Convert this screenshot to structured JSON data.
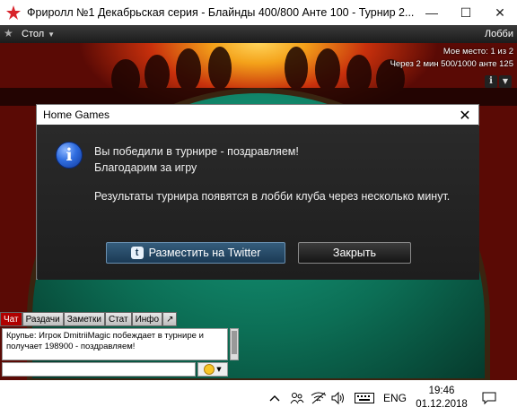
{
  "window": {
    "title": "Фриролл №1 Декабрьская серия - Блайнды 400/800 Анте 100 - Турнир 2...",
    "minimize": "—",
    "maximize": "☐",
    "close": "✕"
  },
  "table": {
    "menu_label": "Стол",
    "lobby_label": "Лобби",
    "my_place": "Мое место: 1 из 2",
    "next_level": "Через 2 мин 500/1000 анте 125",
    "info_button": "i"
  },
  "dialog": {
    "title": "Home Games",
    "line1": "Вы победили в турнире - поздравляем!",
    "line2": "Благодарим за игру",
    "line3": "Результаты турнира появятся в лобби клуба через несколько минут.",
    "twitter_button": "Разместить на Twitter",
    "close_button": "Закрыть"
  },
  "chat": {
    "tabs": [
      "Чат",
      "Раздачи",
      "Заметки",
      "Стат",
      "Инфо",
      "↗"
    ],
    "message": "Крупье: Игрок DmitriiMagic побеждает в турнире и получает 198900 - поздравляем!"
  },
  "taskbar": {
    "lang": "ENG",
    "time": "19:46",
    "date": "01.12.2018"
  },
  "colors": {
    "accent_red": "#b00000",
    "felt": "#0c6e55",
    "info_blue": "#2f6de0"
  }
}
